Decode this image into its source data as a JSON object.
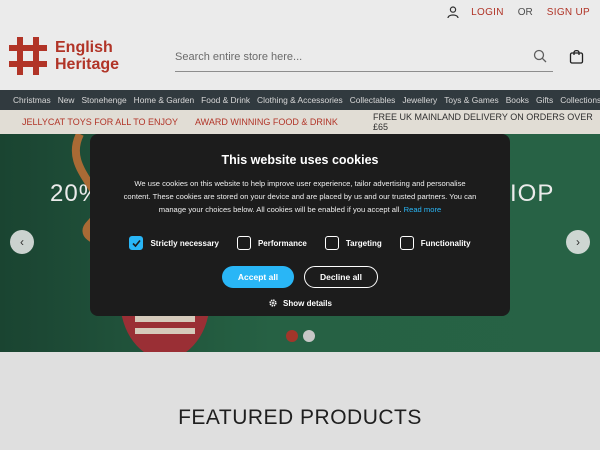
{
  "header": {
    "login_label": "LOGIN",
    "or_label": "OR",
    "signup_label": "SIGN UP",
    "logo_line1": "English",
    "logo_line2": "Heritage",
    "search_placeholder": "Search entire store here..."
  },
  "nav": {
    "items": [
      "Christmas",
      "New",
      "Stonehenge",
      "Home & Garden",
      "Food & Drink",
      "Clothing & Accessories",
      "Collectables",
      "Jewellery",
      "Toys & Games",
      "Books",
      "Gifts",
      "Collections"
    ]
  },
  "promo": {
    "items": [
      "JELLYCAT TOYS FOR ALL TO ENJOY",
      "AWARD WINNING FOOD & DRINK",
      "FREE UK MAINLAND DELIVERY ON ORDERS OVER £65"
    ]
  },
  "hero": {
    "left_text": "20%",
    "right_text": "IOP",
    "prev_arrow": "›",
    "next_arrow": "›"
  },
  "cookie_modal": {
    "title": "This website uses cookies",
    "body": "We use cookies on this website to help improve user experience, tailor advertising and personalise content. These cookies are stored on your device and are placed by us and our trusted partners. You can manage your choices below. All cookies will be enabled if you accept all.",
    "read_more": "Read more",
    "options": [
      {
        "label": "Strictly necessary",
        "checked": true
      },
      {
        "label": "Performance",
        "checked": false
      },
      {
        "label": "Targeting",
        "checked": false
      },
      {
        "label": "Functionality",
        "checked": false
      }
    ],
    "accept_label": "Accept all",
    "decline_label": "Decline all",
    "details_label": "Show details"
  },
  "featured": {
    "title": "FEATURED PRODUCTS"
  },
  "colors": {
    "brand_red": "#c0392b",
    "nav_bg": "#363f45",
    "accent_blue": "#29b6f6",
    "modal_bg": "#1c1c1c"
  }
}
